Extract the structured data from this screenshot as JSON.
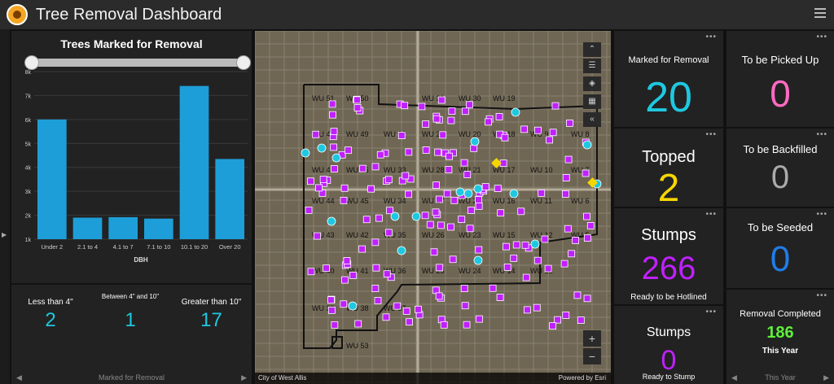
{
  "header": {
    "title": "Tree Removal Dashboard"
  },
  "chart_panel": {
    "title": "Trees Marked for Removal",
    "footer_label": "Marked for Removal"
  },
  "chart_data": {
    "type": "bar",
    "title": "Trees Marked for Removal",
    "xlabel": "DBH",
    "ylabel": "",
    "categories": [
      "Under 2",
      "2.1 to 4",
      "4.1 to 7",
      "7.1 to 10",
      "10.1 to 20",
      "Over 20"
    ],
    "values": [
      6000,
      1900,
      1920,
      1860,
      7400,
      4350
    ],
    "ylim": [
      1000,
      8000
    ],
    "yticks": [
      "1k",
      "2k",
      "3k",
      "4k",
      "5k",
      "6k",
      "7k",
      "8k"
    ],
    "bar_color": "#1e9ed8",
    "grid": true
  },
  "summary": [
    {
      "label": "Less than 4\"",
      "value": "2"
    },
    {
      "label": "Between 4\" and 10\"",
      "value": "1"
    },
    {
      "label": "Greater than 10\"",
      "value": "17"
    }
  ],
  "map": {
    "attribution_left": "City of West Allis",
    "attribution_right": "Powered by Esri",
    "zoom_in": "+",
    "zoom_out": "−",
    "zone_labels": [
      "WU 51",
      "WU 50",
      "WU 31",
      "WU 30",
      "WU 19",
      "WU 48",
      "WU 49",
      "WU 32",
      "WU 29",
      "WU 20",
      "WU 18",
      "WU 9",
      "WU 8",
      "WU 47",
      "WU 46",
      "WU 33",
      "WU 28",
      "WU 21",
      "WU 17",
      "WU 10",
      "WU 7",
      "WU 44",
      "WU 45",
      "WU 34",
      "WU 27",
      "WU 22",
      "WU 16",
      "WU 11",
      "WU 6",
      "WU 43",
      "WU 42",
      "WU 35",
      "WU 26",
      "WU 23",
      "WU 15",
      "WU 12",
      "WU 5",
      "WU 40",
      "WU 41",
      "WU 36",
      "WU 25",
      "WU 24",
      "WU 14",
      "WU 13",
      "WU 39",
      "WU 38",
      "WU 37",
      "WU 53"
    ]
  },
  "metrics": {
    "marked": {
      "label": "Marked for Removal",
      "value": "20",
      "color": "#1ec8e0"
    },
    "topped": {
      "label": "Topped",
      "value": "2",
      "color": "#f7d600"
    },
    "stumps_hot": {
      "label": "Stumps",
      "value": "266",
      "sub": "Ready to be Hotlined",
      "color": "#c020ff"
    },
    "stumps_ready": {
      "label": "Stumps",
      "value": "0",
      "sub": "Ready to Stump",
      "color": "#c020ff"
    },
    "picked": {
      "label": "To be Picked Up",
      "value": "0",
      "color": "#ff6ac1"
    },
    "backfilled": {
      "label": "To be Backfilled",
      "value": "0",
      "color": "#aaaaaa"
    },
    "seeded": {
      "label": "To be Seeded",
      "value": "0",
      "color": "#1f7de8"
    },
    "completed": {
      "label": "Removal Completed",
      "value": "186",
      "sub": "This Year",
      "color": "#5ef03a"
    },
    "completed_footer": "This Year"
  }
}
